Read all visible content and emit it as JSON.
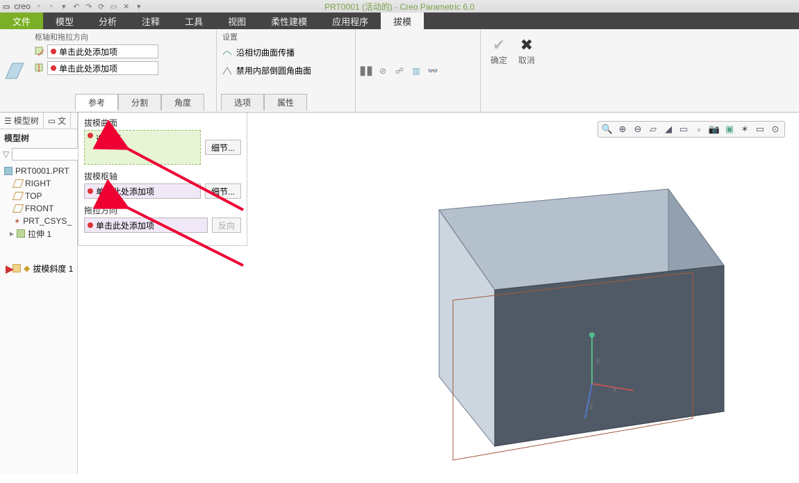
{
  "app": {
    "logo": "creo",
    "title": "PRT0001 (活动的) - Creo Parametric 6.0"
  },
  "menubar": [
    "文件",
    "模型",
    "分析",
    "注释",
    "工具",
    "视图",
    "柔性建模",
    "应用程序",
    "拔模"
  ],
  "menubar_active": "拔模",
  "ribbon": {
    "group1": {
      "label": "枢轴和拖拉方向",
      "collector1_placeholder": "单击此处添加项",
      "collector2_placeholder": "单击此处添加项"
    },
    "group2": {
      "label": "设置",
      "opt1": "沿相切曲面传播",
      "opt2": "禁用内部倒圆角曲面"
    },
    "ok": "确定",
    "cancel": "取消",
    "tabs": [
      "参考",
      "分割",
      "角度",
      "选项",
      "属性"
    ],
    "tabs_active": "参考"
  },
  "tree": {
    "tabs": {
      "modeltree": "模型树"
    },
    "header": "模型树",
    "part": "PRT0001.PRT",
    "datums": [
      "RIGHT",
      "TOP",
      "FRONT"
    ],
    "csys": "PRT_CSYS_",
    "extrude": "拉伸 1",
    "draft": "拔模斜度 1"
  },
  "dash": {
    "sec1": {
      "label": "拔模曲面",
      "value": "选择项",
      "btn": "细节..."
    },
    "sec2": {
      "label": "拔模枢轴",
      "value": "单击此处添加项",
      "btn": "细节..."
    },
    "sec3": {
      "label": "拖拉方向",
      "value": "单击此处添加项",
      "btn": "反向"
    }
  },
  "axes": {
    "x": "x",
    "y": "y",
    "z": "z"
  }
}
